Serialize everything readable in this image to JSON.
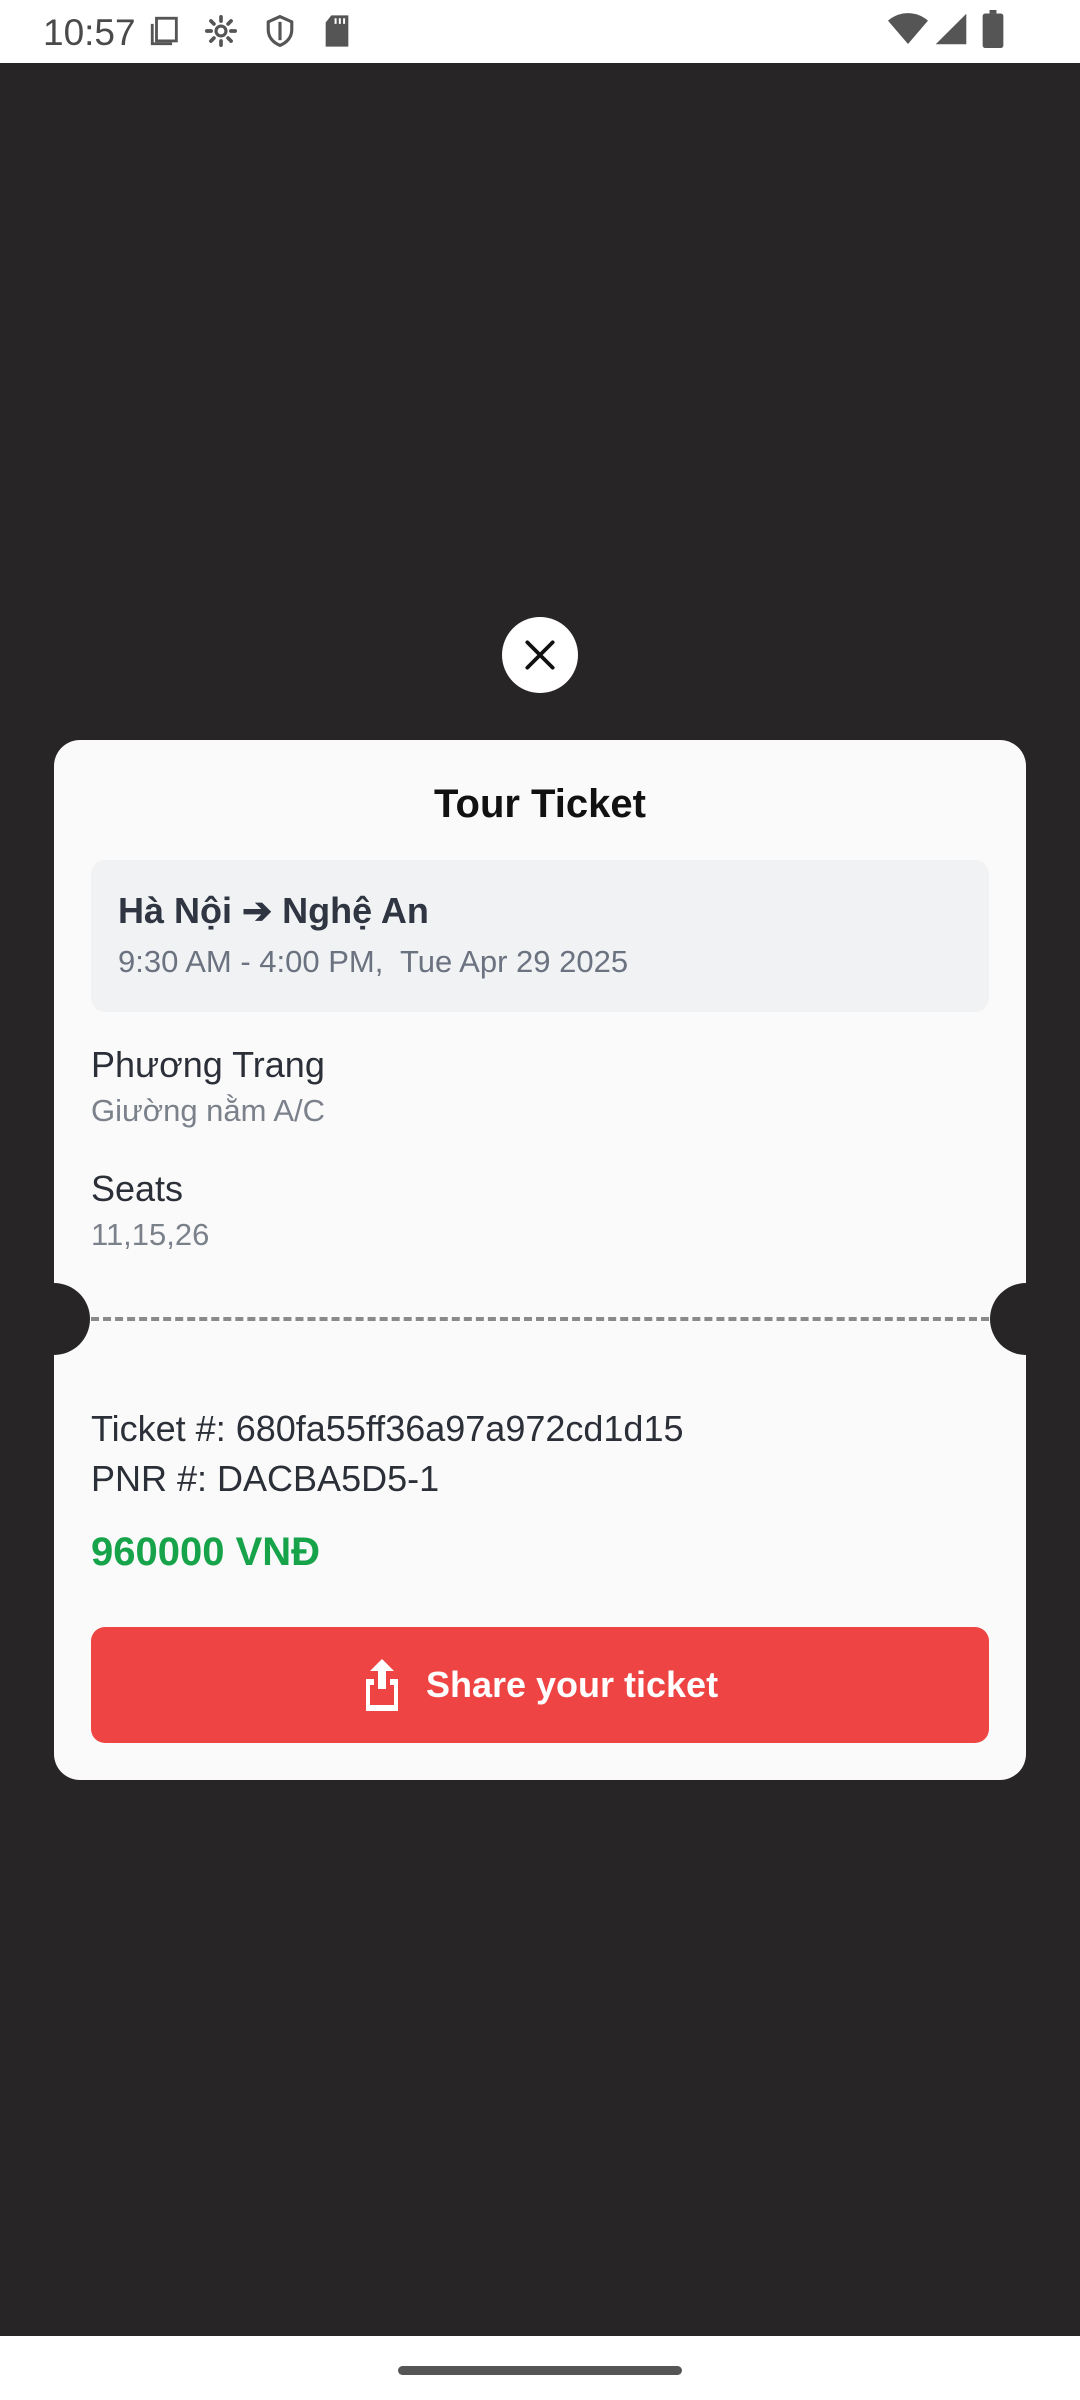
{
  "status_bar": {
    "time": "10:57",
    "icons": [
      "screenshot-icon",
      "settings-gear-icon",
      "shield-icon",
      "sd-card-icon",
      "wifi-icon",
      "signal-icon",
      "battery-icon"
    ]
  },
  "ticket": {
    "title": "Tour Ticket",
    "route": "Hà Nội ➔ Nghệ An",
    "time_range": "9:30 AM - 4:00 PM,  Tue Apr 29 2025",
    "operator": "Phương Trang",
    "bus_type": "Giường nằm A/C",
    "seats_label": "Seats",
    "seats": "11,15,26",
    "ticket_number": "Ticket #: 680fa55ff36a97a972cd1d15",
    "pnr": "PNR #: DACBA5D5-1",
    "price": "960000 VNĐ",
    "share_label": "Share your ticket"
  },
  "colors": {
    "backdrop": "#282527",
    "card": "#fafafa",
    "price_green": "#16a34a",
    "share_red": "#ef4444"
  }
}
